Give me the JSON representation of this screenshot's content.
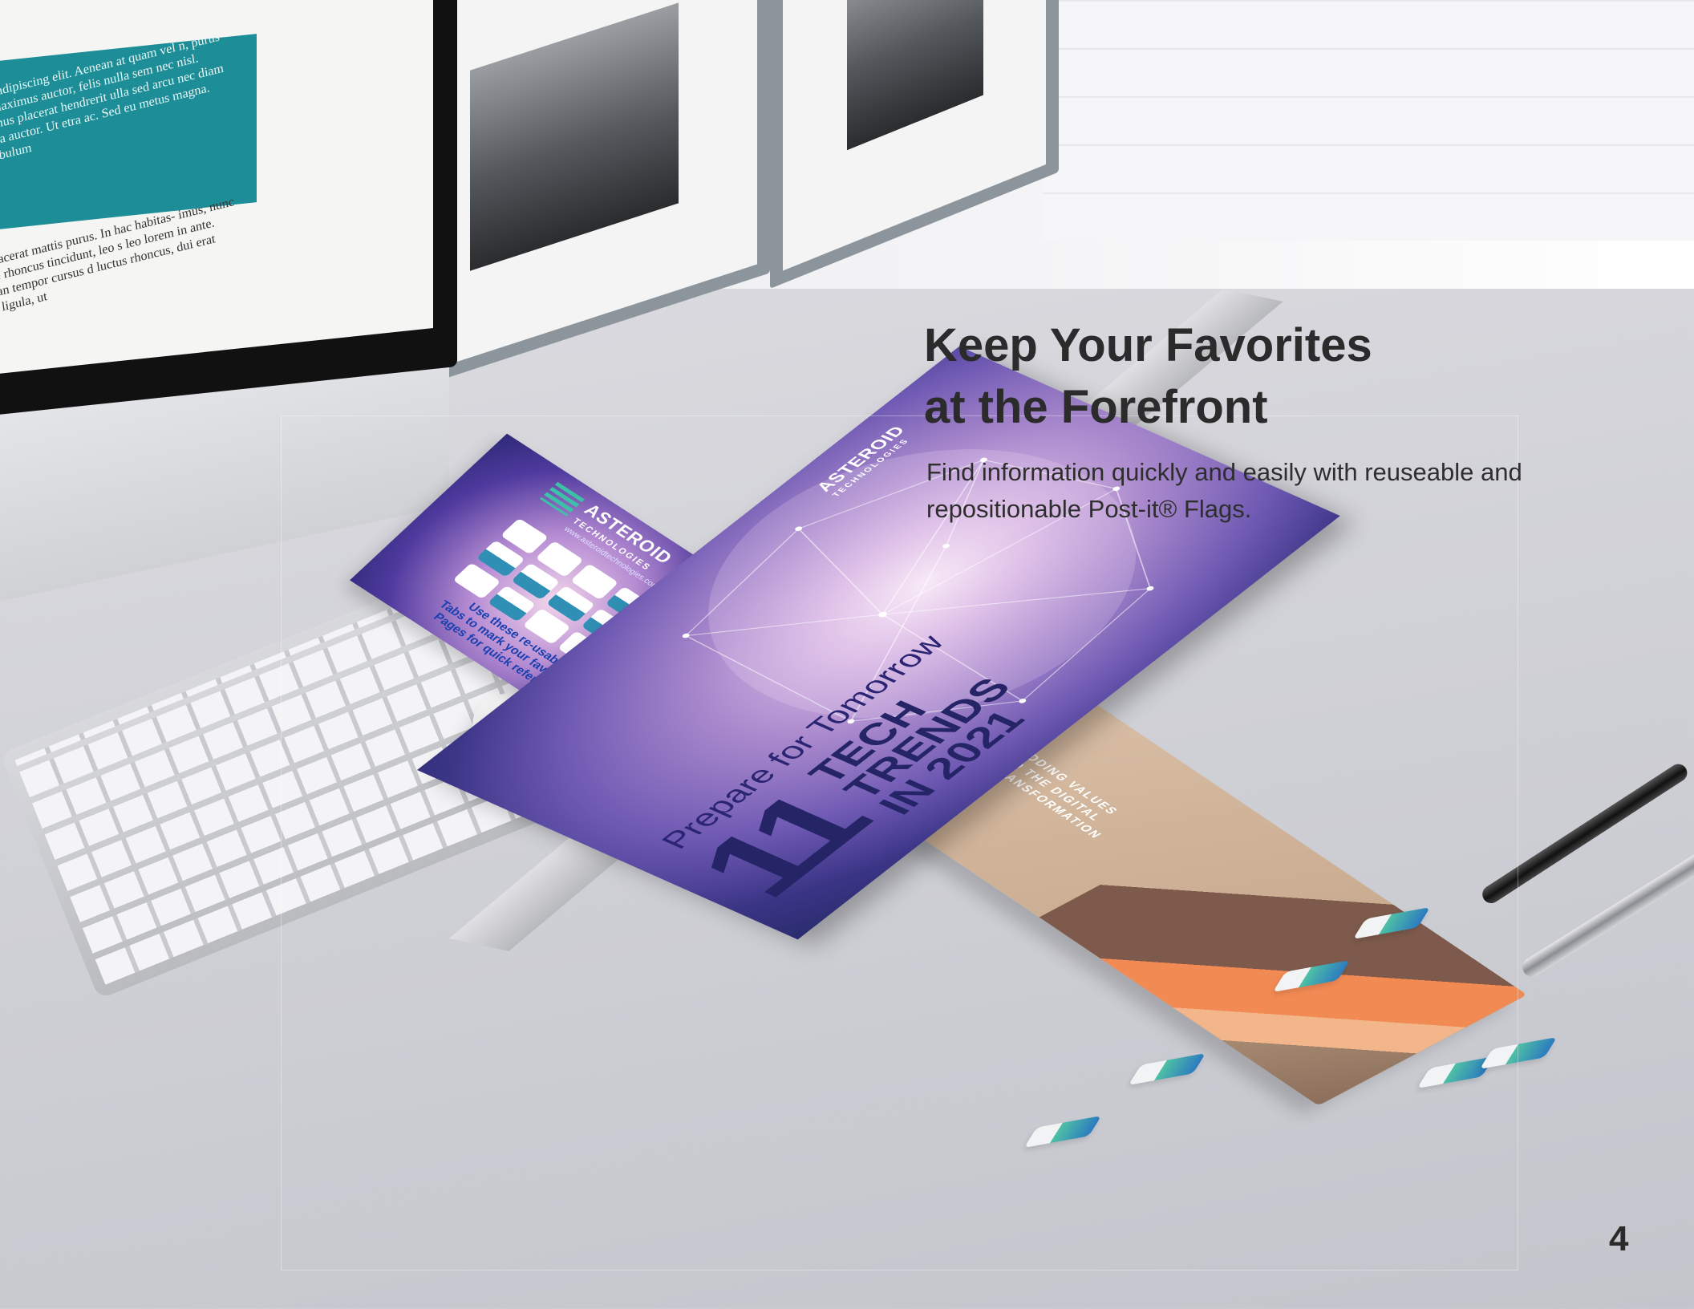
{
  "content": {
    "headline_line1": "Keep Your Favorites",
    "headline_line2": "at the Forefront",
    "body_line1": "Find information quickly and easily with reuseable and",
    "body_line2": "repositionable Post-it® Flags.",
    "page_number": "4"
  },
  "flyer": {
    "brand": "ASTEROID",
    "brand_sub": "TECHNOLOGIES",
    "url": "www.asteroidtechnologies.com",
    "cta_line1": "Use these re-usable",
    "cta_line2": "Tabs to mark your favourite",
    "cta_line3": "Pages for quick reference"
  },
  "book": {
    "brand": "ASTEROID",
    "brand_sub": "TECHNOLOGIES",
    "subtitle": "Prepare for Tomorrow",
    "big_number": "11",
    "title_line1": "TECH",
    "title_line2": "TRENDS",
    "title_line3": "IN 2021"
  },
  "notebook": {
    "line1": "ADDING VALUES",
    "line2": "TO THE DIGITAL",
    "line3": "TRANSFORMATION"
  },
  "monitor": {
    "text1": "ctetur adipiscing elit. Aenean at quam vel n, purus quis maximus auctor, felis nulla sem nec nisl. Vivamus placerat hendrerit ulla sed arcu nec diam lacinia auctor. Ut etra ac. Sed eu metus magna. Vestibulum",
    "text2": "i et, placerat mattis purus. In hac habitas- imus, nunc ornare rhoncus tincidunt, leo s leo lorem in ante. Aenean tempor cursus d luctus rhoncus, dui erat porta ligula, ut"
  },
  "colors": {
    "headline": "#2b2b2b",
    "teal": "#1d8e97",
    "tab_green": "#4fc0a5",
    "tab_blue": "#2c7bbf",
    "book_navy": "#242467"
  }
}
